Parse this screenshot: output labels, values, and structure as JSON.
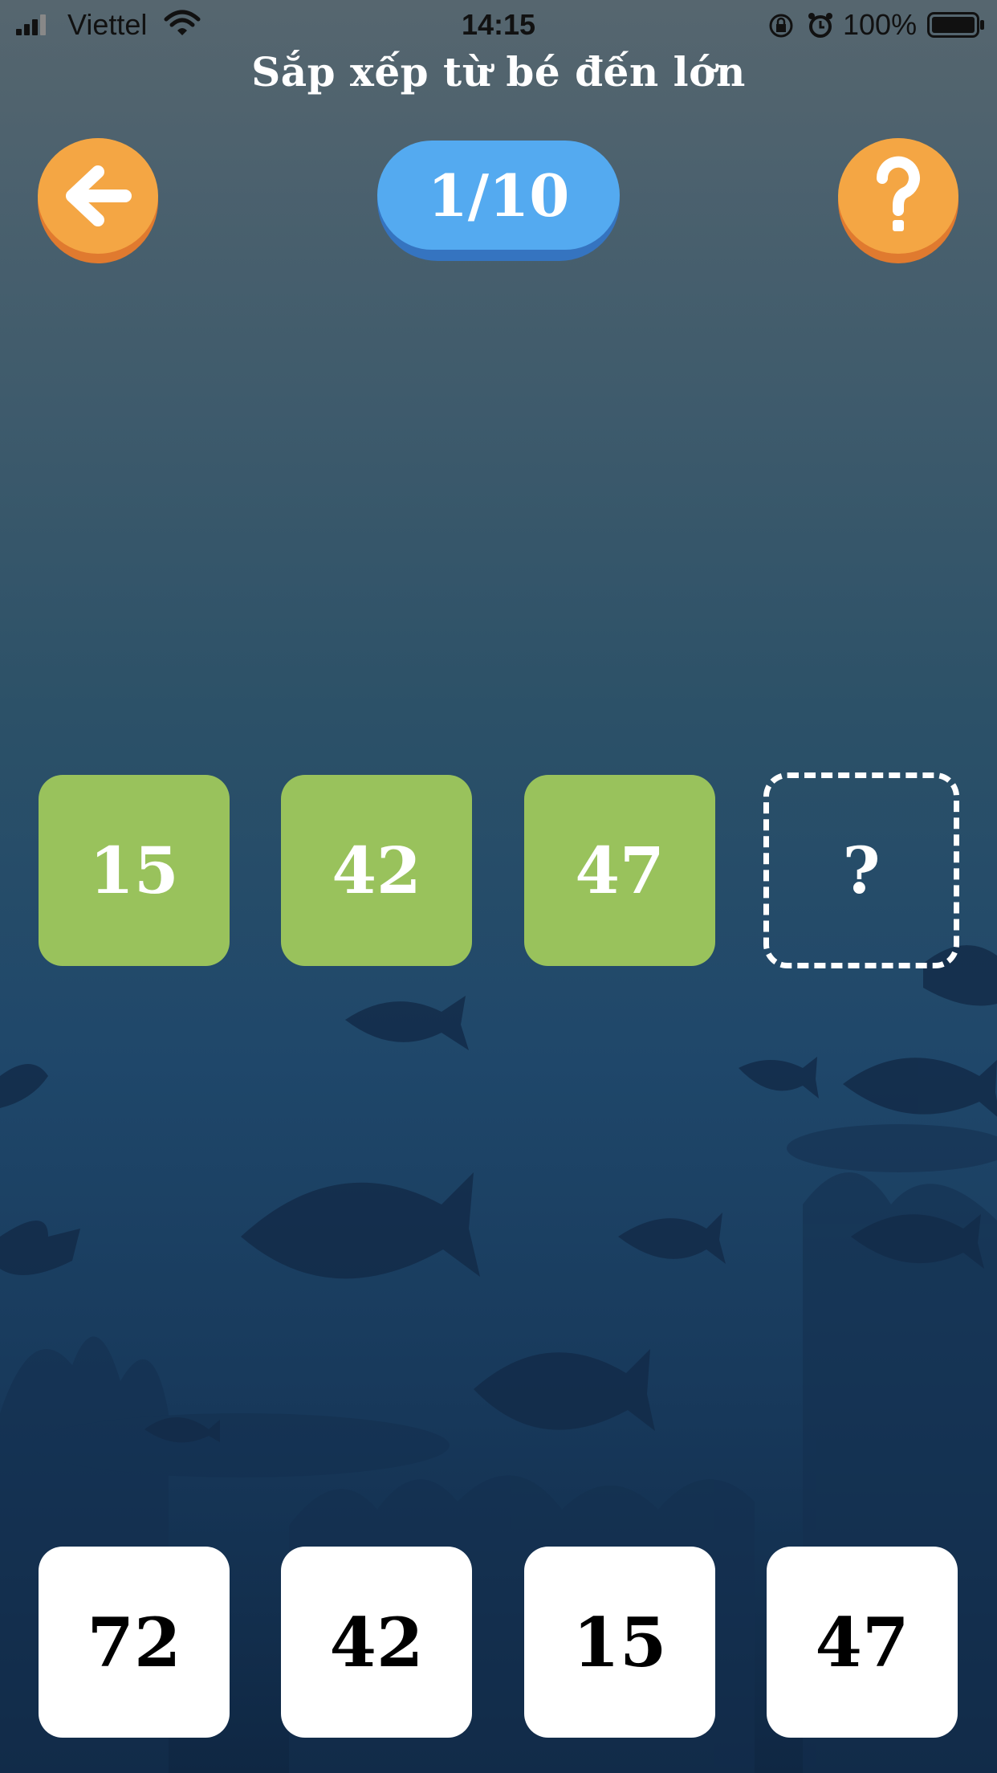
{
  "status_bar": {
    "carrier": "Viettel",
    "time": "14:15",
    "battery_percent": "100%"
  },
  "title": "Sắp xếp từ bé đến lớn",
  "progress": "1/10",
  "answer_slots": [
    {
      "value": "15"
    },
    {
      "value": "42"
    },
    {
      "value": "47"
    },
    {
      "value": "?"
    }
  ],
  "choices": [
    {
      "value": "72"
    },
    {
      "value": "42"
    },
    {
      "value": "15"
    },
    {
      "value": "47"
    }
  ],
  "icons": {
    "back": "arrow-left-icon",
    "help": "question-mark-icon"
  },
  "colors": {
    "orange_button": "#f4a644",
    "progress_pill": "#54aaf0",
    "filled_tile": "#99c25c",
    "choice_tile": "#ffffff"
  }
}
